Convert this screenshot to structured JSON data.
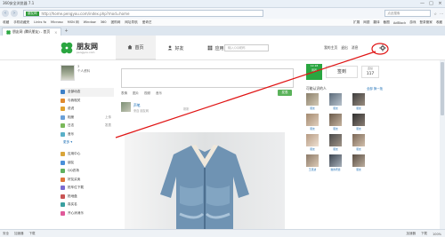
{
  "window": {
    "title": "360安全浏览器 7.1",
    "controls": [
      "—",
      "□",
      "×"
    ]
  },
  "toolbar": {
    "back": "‹",
    "forward": "›",
    "secure_label": "朋友网",
    "url": "http://home.pengyou.com/index.php?mod=home",
    "search_placeholder": "点此搜索",
    "right_items": [
      "☆",
      "⋯"
    ]
  },
  "bookmarks": {
    "left": [
      "收藏",
      "手机收藏夹",
      "Links fo",
      "Microso",
      "MSN 网",
      "Window",
      "360",
      "团购网",
      "网址导航",
      "爱奇艺"
    ],
    "right": [
      "扩展",
      "网银",
      "翻译",
      "截图",
      "AdBlock",
      "游戏",
      "登录管家",
      "收藏"
    ]
  },
  "tabs": [
    {
      "label": "朋友网 (腾讯朋友) - 首页",
      "close": "×"
    }
  ],
  "tab_new": "+",
  "site": {
    "logo_text": "朋友网",
    "logo_sub": "pengyou.com",
    "nav": [
      {
        "label": "首页",
        "icon": "home-icon"
      },
      {
        "label": "好友",
        "icon": "person-icon"
      },
      {
        "label": "应用",
        "icon": "apps-icon"
      }
    ],
    "search_placeholder": "输入QQ昵称",
    "user_nav": [
      "我的主页",
      "退出",
      "消息"
    ]
  },
  "sidebar": {
    "profile_name": "3",
    "profile_meta": "个人资料",
    "items": [
      {
        "label": "全部动态",
        "color": "#3b7fc7",
        "extra": ""
      },
      {
        "label": "与我相关",
        "color": "#e08a2e",
        "extra": ""
      },
      {
        "label": "说说",
        "color": "#e0a12e",
        "extra": ""
      },
      {
        "label": "相册",
        "color": "#6aa0d8",
        "extra": "上传"
      },
      {
        "label": "日志",
        "color": "#7ab85a",
        "extra": "发表"
      },
      {
        "label": "音乐",
        "color": "#5ab0c8",
        "extra": ""
      }
    ],
    "more_label": "更多 ▾",
    "apps": [
      {
        "label": "应用中心",
        "color": "#d9a53a"
      },
      {
        "label": "朋友",
        "color": "#4a90d9"
      },
      {
        "label": "QQ农场",
        "color": "#5fb05f"
      },
      {
        "label": "好友买卖",
        "color": "#e0743a"
      },
      {
        "label": "抢车位下载",
        "color": "#7a6ad0"
      },
      {
        "label": "抢地盘",
        "color": "#c95555"
      },
      {
        "label": "真实名",
        "color": "#3aa0a0"
      },
      {
        "label": "开心消消乐",
        "color": "#e05a9a"
      }
    ]
  },
  "composer": {
    "tools": [
      "表情",
      "图片",
      "视频",
      "音乐"
    ],
    "publish": "发表"
  },
  "post": {
    "author": "声笔",
    "meta": "来自 朋友网",
    "time": "刚刚"
  },
  "rightcol": {
    "date_top": "12.18",
    "date_mid": "周四",
    "checkin": "签到",
    "days_label": "连续",
    "days_num": "117",
    "friends_title": "可能认识的人",
    "friends_all": "全部 换一批",
    "friends": [
      "朋友",
      "朋友",
      "朋友",
      "朋友",
      "朋友",
      "朋友",
      "朋友",
      "朋友",
      "朋友",
      "王灵波",
      "谁的老婆",
      "朋友"
    ]
  },
  "status": {
    "left": [
      "安全",
      "加速器",
      "下载"
    ],
    "right": [
      "加速器",
      "下载",
      "100%"
    ]
  },
  "colors": {
    "brand_green": "#2aa640",
    "link_blue": "#1a6db5",
    "annotation_red": "#e01414"
  }
}
